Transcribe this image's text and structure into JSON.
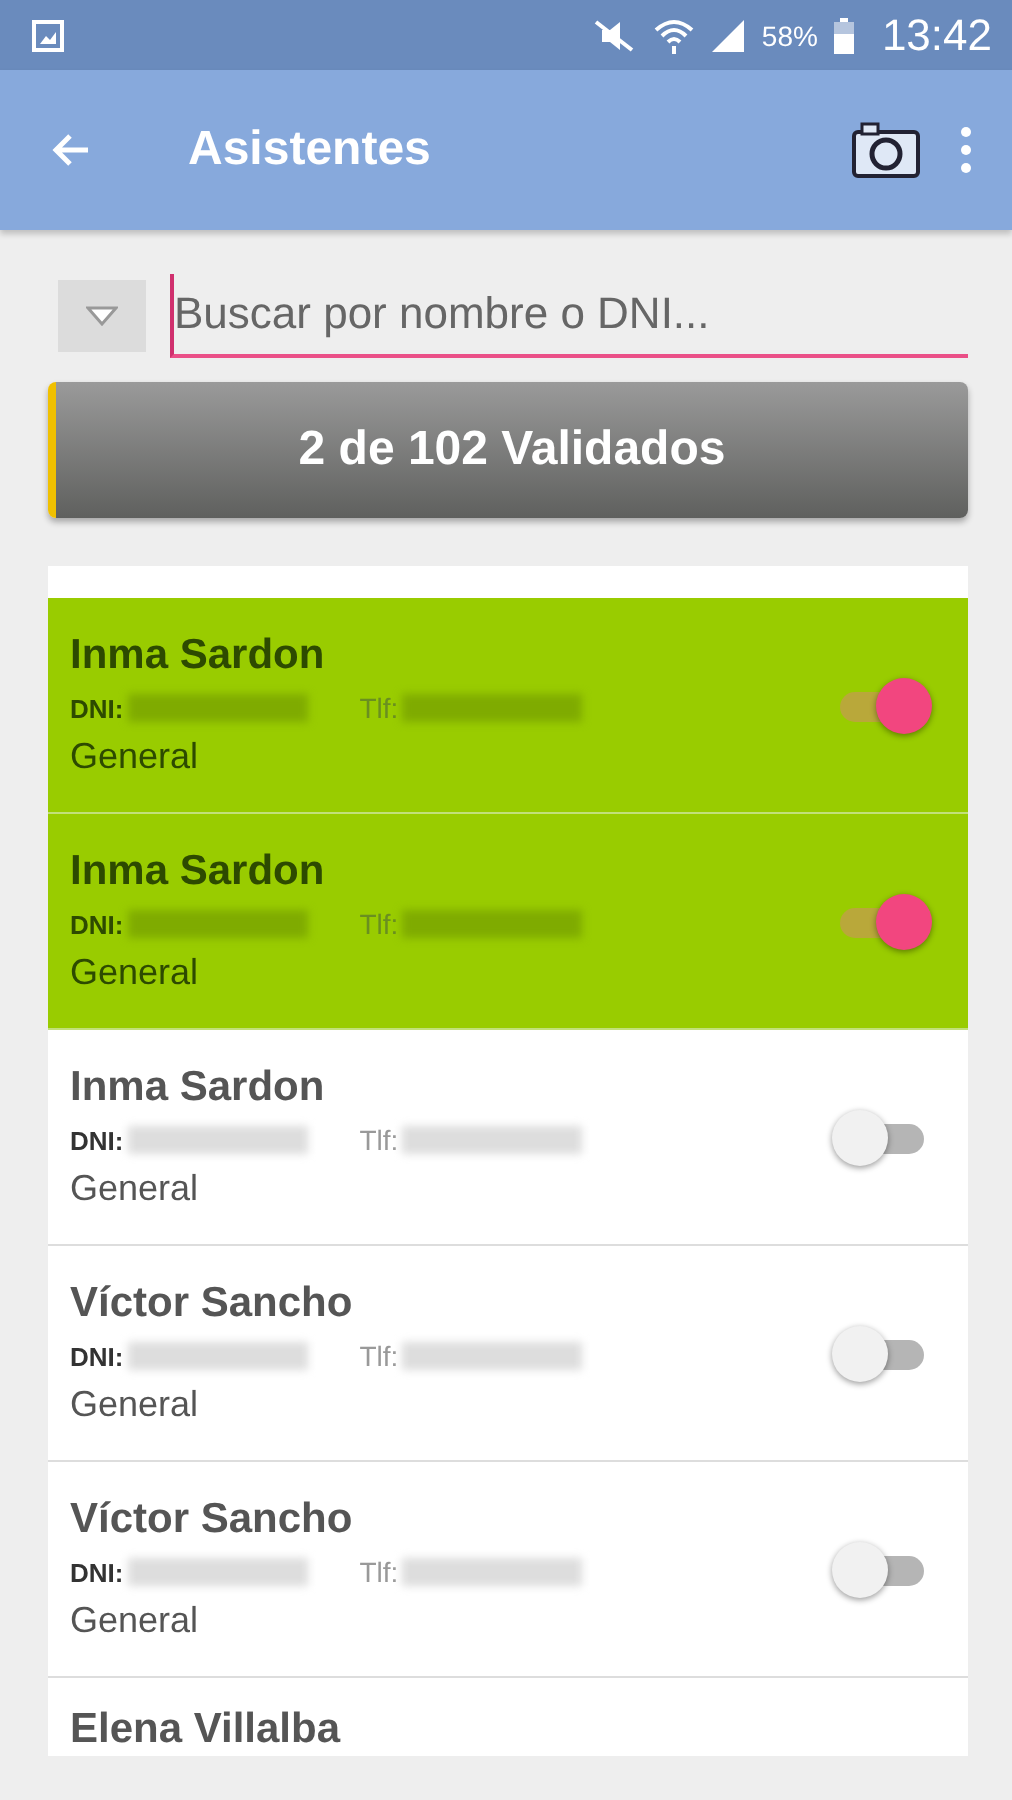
{
  "status_bar": {
    "battery": "58%",
    "time": "13:42"
  },
  "app_bar": {
    "title": "Asistentes"
  },
  "search": {
    "placeholder": "Buscar por nombre o DNI..."
  },
  "summary": "2 de 102 Validados",
  "attendees": [
    {
      "name": "Inma Sardon",
      "dni_label": "DNI:",
      "phone_label": "Tlf:",
      "category": "General",
      "validated": true
    },
    {
      "name": "Inma Sardon",
      "dni_label": "DNI:",
      "phone_label": "Tlf:",
      "category": "General",
      "validated": true
    },
    {
      "name": "Inma Sardon",
      "dni_label": "DNI:",
      "phone_label": "Tlf:",
      "category": "General",
      "validated": false
    },
    {
      "name": "Víctor Sancho",
      "dni_label": "DNI:",
      "phone_label": "Tlf:",
      "category": "General",
      "validated": false
    },
    {
      "name": "Víctor Sancho",
      "dni_label": "DNI:",
      "phone_label": "Tlf:",
      "category": "General",
      "validated": false
    },
    {
      "kind": "name-only",
      "name": "Elena Villalba"
    }
  ]
}
